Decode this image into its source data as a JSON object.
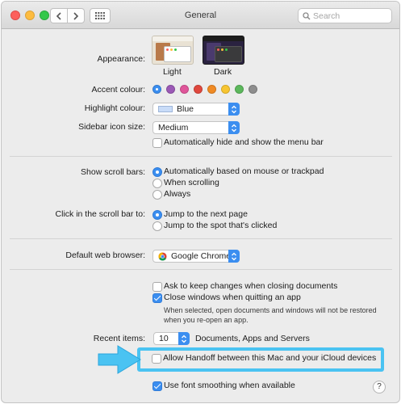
{
  "window": {
    "title": "General"
  },
  "search": {
    "placeholder": "Search"
  },
  "appearance": {
    "label": "Appearance:",
    "options": [
      "Light",
      "Dark"
    ]
  },
  "accent": {
    "label": "Accent colour:",
    "colors": [
      "#3b8ef0",
      "#9b59b6",
      "#e0559a",
      "#e0483e",
      "#f08a24",
      "#f7c531",
      "#5cb85c",
      "#8e8e8e"
    ]
  },
  "highlight": {
    "label": "Highlight colour:",
    "value": "Blue",
    "swatch": "#c9dcf8"
  },
  "sidebar_icon": {
    "label": "Sidebar icon size:",
    "value": "Medium"
  },
  "menu_bar": {
    "label": "Automatically hide and show the menu bar",
    "checked": false
  },
  "scroll_bars": {
    "label": "Show scroll bars:",
    "options": [
      "Automatically based on mouse or trackpad",
      "When scrolling",
      "Always"
    ],
    "selected": 0
  },
  "scroll_click": {
    "label": "Click in the scroll bar to:",
    "options": [
      "Jump to the next page",
      "Jump to the spot that's clicked"
    ],
    "selected": 0
  },
  "browser": {
    "label": "Default web browser:",
    "value": "Google Chrome"
  },
  "ask_changes": {
    "label": "Ask to keep changes when closing documents",
    "checked": false
  },
  "close_windows": {
    "label": "Close windows when quitting an app",
    "checked": true,
    "note_line1": "When selected, open documents and windows will not be restored",
    "note_line2": "when you re-open an app."
  },
  "recent_items": {
    "label": "Recent items:",
    "value": "10",
    "suffix": "Documents, Apps and Servers"
  },
  "handoff": {
    "label": "Allow Handoff between this Mac and your iCloud devices",
    "checked": false
  },
  "font_smoothing": {
    "label": "Use font smoothing when available",
    "checked": true
  },
  "help": {
    "label": "?"
  },
  "colors": {
    "accent": "#3b8ef0",
    "annotation": "#4ac3f2"
  }
}
